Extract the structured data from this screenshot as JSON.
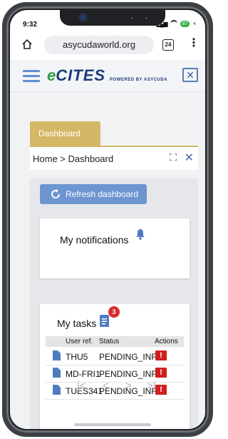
{
  "status_bar": {
    "time": "9:32",
    "battery": "87"
  },
  "browser": {
    "url": "asycudaworld.org",
    "tab_count": "24"
  },
  "site_header": {
    "logo_e": "e",
    "logo_name": "CITES",
    "logo_powered": "POWERED BY ASYCUDA"
  },
  "dashboard": {
    "tab_label": "Dashboard",
    "breadcrumb": "Home > Dashboard",
    "refresh_label": "Refresh dashboard",
    "notifications_title": "My notifications",
    "tasks": {
      "title": "My tasks",
      "badge_count": "3",
      "columns": [
        "User ref.",
        "Status",
        "Actions"
      ],
      "rows": [
        {
          "ref": "THU5",
          "status": "PENDING_INFO"
        },
        {
          "ref": "MD-FRI1",
          "status": "PENDING_INFO"
        },
        {
          "ref": "TUES341",
          "status": "PENDING_INFO"
        }
      ],
      "pager": [
        "|<",
        "<",
        ">",
        ">|"
      ]
    }
  },
  "colors": {
    "tab_gold": "#d4b866",
    "button_blue": "#6d95d2",
    "alert_red": "#d11f1f",
    "logo_green": "#2f9e44",
    "logo_navy": "#1d3b7a"
  }
}
